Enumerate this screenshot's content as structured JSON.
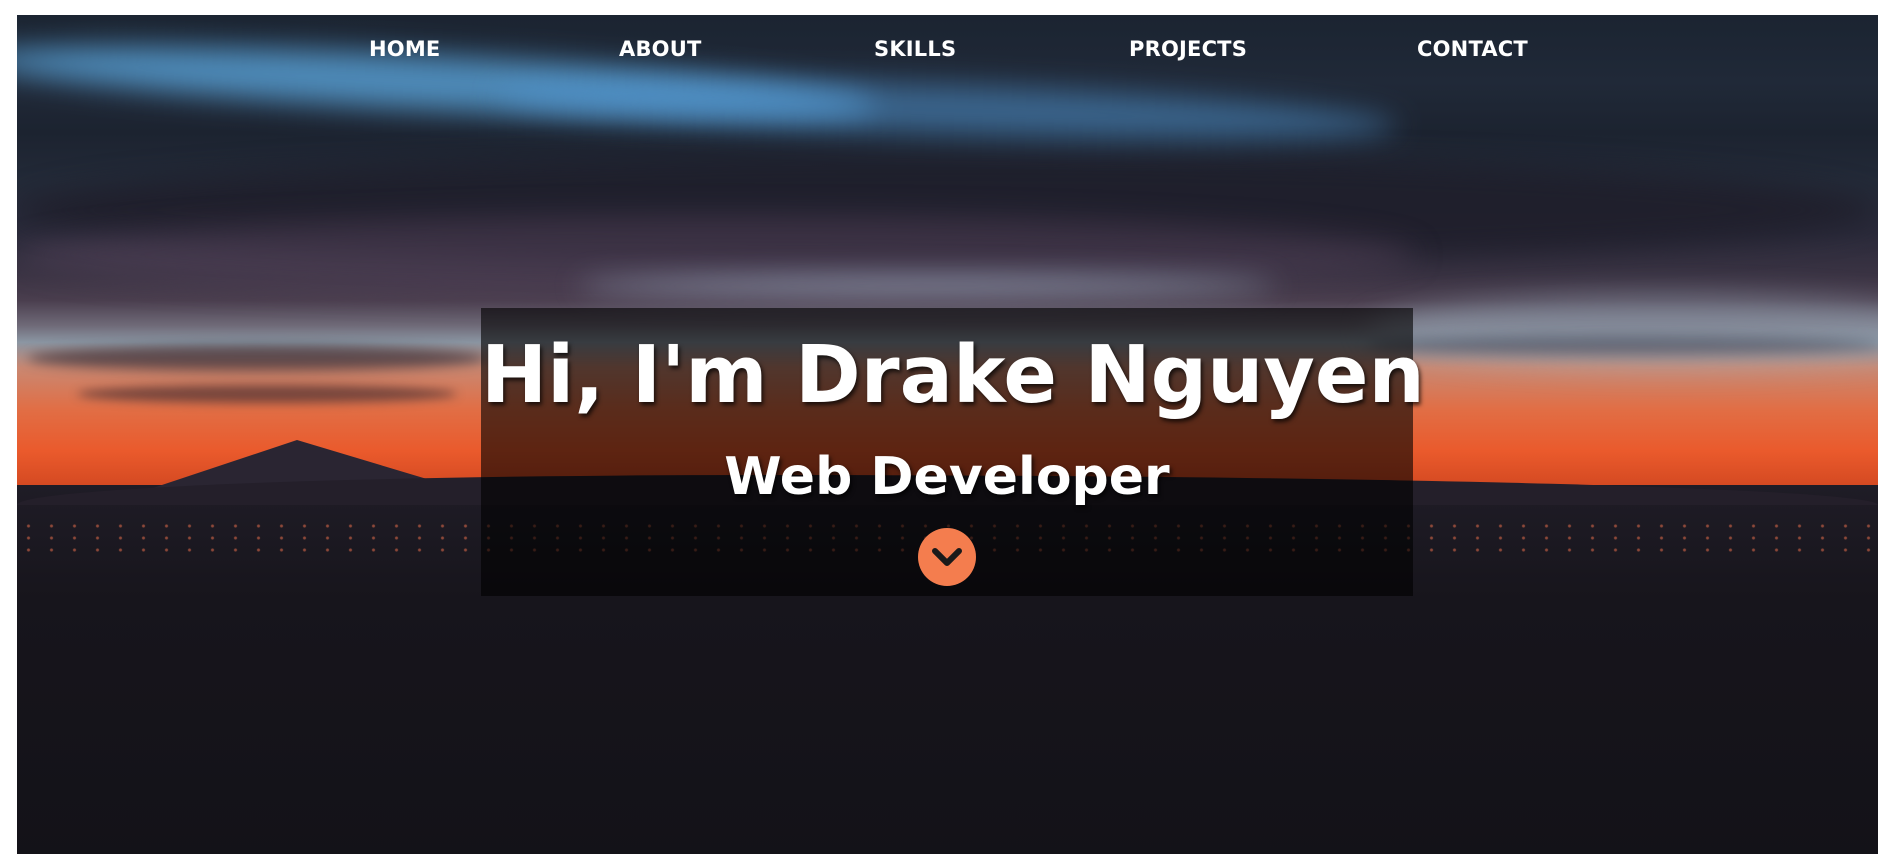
{
  "nav": {
    "items": [
      {
        "label": "HOME"
      },
      {
        "label": "ABOUT"
      },
      {
        "label": "SKILLS"
      },
      {
        "label": "PROJECTS"
      },
      {
        "label": "CONTACT"
      }
    ]
  },
  "hero": {
    "title": "Hi, I'm Drake Nguyen",
    "subtitle": "Web Developer",
    "scroll_icon": "chevron-down-icon"
  },
  "colors": {
    "accent": "#f47d4e",
    "nav_text": "#ffffff",
    "hero_overlay": "#000000"
  }
}
